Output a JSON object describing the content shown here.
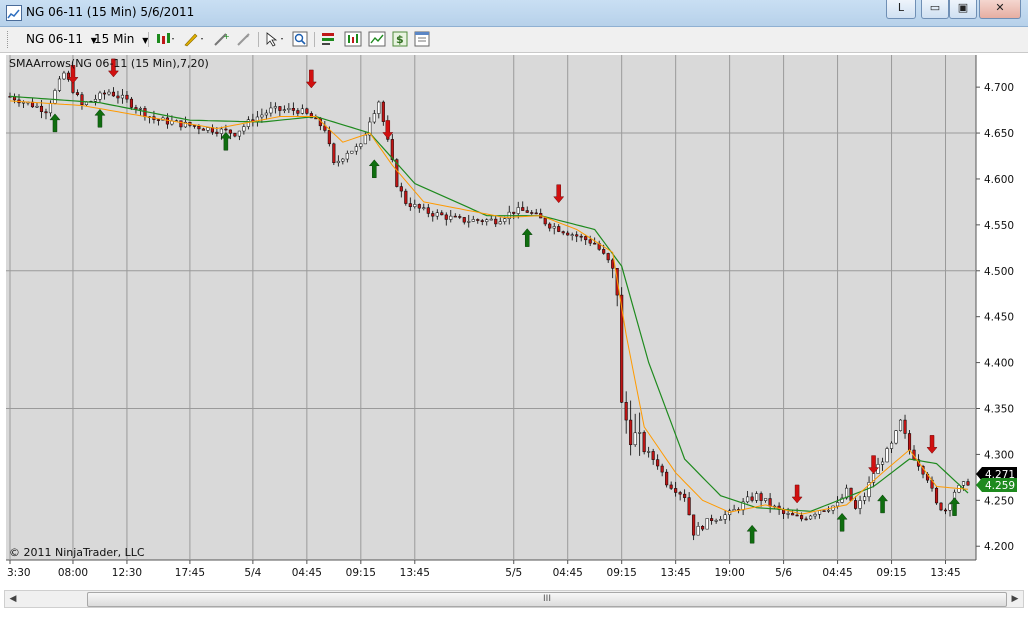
{
  "window": {
    "title": "NG 06-11 (15 Min)  5/6/2011",
    "btn_l": "L",
    "btn_min": "▭",
    "btn_max": "▣",
    "btn_close": "✕"
  },
  "toolbar": {
    "instrument": "NG 06-11",
    "interval": "15 Min"
  },
  "scroll": {
    "grip": "III"
  },
  "chart_data": {
    "type": "candlestick",
    "indicator_label": "SMAArrows(NG 06-11 (15 Min),7,20)",
    "copyright": "© 2011 NinjaTrader, LLC",
    "price_axis": {
      "ylim": [
        4.185,
        4.735
      ],
      "ticks": [
        "4.700",
        "4.650",
        "4.600",
        "4.550",
        "4.500",
        "4.450",
        "4.400",
        "4.350",
        "4.300",
        "4.250",
        "4.200"
      ],
      "tick_values": [
        4.7,
        4.65,
        4.6,
        4.55,
        4.5,
        4.45,
        4.4,
        4.35,
        4.3,
        4.25,
        4.2
      ],
      "last_price": "4.271",
      "sma_value": "4.259"
    },
    "time_axis": {
      "labels": [
        "3:30",
        "08:00",
        "12:30",
        "17:45",
        "5/4",
        "04:45",
        "09:15",
        "13:45",
        "5/5",
        "04:45",
        "09:15",
        "13:45",
        "19:00",
        "5/6",
        "04:45",
        "09:15",
        "13:45"
      ],
      "bar_index": [
        0,
        14,
        26,
        40,
        54,
        66,
        78,
        90,
        112,
        124,
        136,
        148,
        160,
        172,
        184,
        196,
        208
      ]
    },
    "total_bars": 214,
    "price_anchors": [
      [
        0,
        4.69
      ],
      [
        8,
        4.675
      ],
      [
        12,
        4.715
      ],
      [
        16,
        4.68
      ],
      [
        22,
        4.695
      ],
      [
        26,
        4.685
      ],
      [
        32,
        4.665
      ],
      [
        38,
        4.66
      ],
      [
        44,
        4.655
      ],
      [
        50,
        4.65
      ],
      [
        54,
        4.665
      ],
      [
        58,
        4.675
      ],
      [
        64,
        4.675
      ],
      [
        66,
        4.67
      ],
      [
        70,
        4.655
      ],
      [
        72,
        4.615
      ],
      [
        75,
        4.63
      ],
      [
        78,
        4.635
      ],
      [
        80,
        4.665
      ],
      [
        82,
        4.685
      ],
      [
        84,
        4.64
      ],
      [
        86,
        4.595
      ],
      [
        88,
        4.575
      ],
      [
        92,
        4.565
      ],
      [
        100,
        4.555
      ],
      [
        108,
        4.555
      ],
      [
        112,
        4.565
      ],
      [
        115,
        4.565
      ],
      [
        120,
        4.55
      ],
      [
        125,
        4.54
      ],
      [
        130,
        4.53
      ],
      [
        133,
        4.51
      ],
      [
        135,
        4.48
      ],
      [
        136,
        4.35
      ],
      [
        138,
        4.325
      ],
      [
        140,
        4.31
      ],
      [
        144,
        4.29
      ],
      [
        146,
        4.27
      ],
      [
        150,
        4.255
      ],
      [
        152,
        4.215
      ],
      [
        156,
        4.23
      ],
      [
        160,
        4.235
      ],
      [
        164,
        4.25
      ],
      [
        166,
        4.255
      ],
      [
        172,
        4.235
      ],
      [
        176,
        4.23
      ],
      [
        180,
        4.24
      ],
      [
        184,
        4.245
      ],
      [
        186,
        4.26
      ],
      [
        188,
        4.24
      ],
      [
        190,
        4.255
      ],
      [
        192,
        4.28
      ],
      [
        196,
        4.31
      ],
      [
        198,
        4.335
      ],
      [
        200,
        4.305
      ],
      [
        204,
        4.275
      ],
      [
        206,
        4.245
      ],
      [
        208,
        4.24
      ],
      [
        210,
        4.26
      ],
      [
        213,
        4.27
      ]
    ],
    "sma_fast": [
      [
        0,
        4.685
      ],
      [
        16,
        4.68
      ],
      [
        30,
        4.668
      ],
      [
        46,
        4.655
      ],
      [
        60,
        4.668
      ],
      [
        68,
        4.668
      ],
      [
        74,
        4.64
      ],
      [
        80,
        4.65
      ],
      [
        85,
        4.615
      ],
      [
        92,
        4.575
      ],
      [
        110,
        4.558
      ],
      [
        118,
        4.56
      ],
      [
        126,
        4.545
      ],
      [
        134,
        4.52
      ],
      [
        137,
        4.43
      ],
      [
        141,
        4.33
      ],
      [
        148,
        4.28
      ],
      [
        154,
        4.25
      ],
      [
        160,
        4.237
      ],
      [
        168,
        4.245
      ],
      [
        176,
        4.235
      ],
      [
        186,
        4.245
      ],
      [
        194,
        4.28
      ],
      [
        200,
        4.305
      ],
      [
        206,
        4.265
      ],
      [
        213,
        4.262
      ]
    ],
    "sma_slow": [
      [
        0,
        4.69
      ],
      [
        20,
        4.683
      ],
      [
        40,
        4.664
      ],
      [
        56,
        4.662
      ],
      [
        68,
        4.668
      ],
      [
        80,
        4.65
      ],
      [
        90,
        4.595
      ],
      [
        106,
        4.56
      ],
      [
        118,
        4.56
      ],
      [
        130,
        4.545
      ],
      [
        136,
        4.505
      ],
      [
        142,
        4.4
      ],
      [
        150,
        4.295
      ],
      [
        158,
        4.255
      ],
      [
        166,
        4.242
      ],
      [
        178,
        4.238
      ],
      [
        192,
        4.265
      ],
      [
        200,
        4.295
      ],
      [
        206,
        4.29
      ],
      [
        213,
        4.258
      ]
    ],
    "signals": [
      {
        "bar": 10,
        "dir": "up",
        "price": 4.66
      },
      {
        "bar": 14,
        "dir": "down",
        "price": 4.715
      },
      {
        "bar": 20,
        "dir": "up",
        "price": 4.665
      },
      {
        "bar": 23,
        "dir": "down",
        "price": 4.722
      },
      {
        "bar": 48,
        "dir": "up",
        "price": 4.64
      },
      {
        "bar": 67,
        "dir": "down",
        "price": 4.71
      },
      {
        "bar": 81,
        "dir": "up",
        "price": 4.61
      },
      {
        "bar": 84,
        "dir": "down",
        "price": 4.655
      },
      {
        "bar": 115,
        "dir": "up",
        "price": 4.535
      },
      {
        "bar": 122,
        "dir": "down",
        "price": 4.585
      },
      {
        "bar": 165,
        "dir": "up",
        "price": 4.212
      },
      {
        "bar": 175,
        "dir": "down",
        "price": 4.258
      },
      {
        "bar": 185,
        "dir": "up",
        "price": 4.225
      },
      {
        "bar": 192,
        "dir": "down",
        "price": 4.29
      },
      {
        "bar": 194,
        "dir": "up",
        "price": 4.245
      },
      {
        "bar": 205,
        "dir": "down",
        "price": 4.312
      },
      {
        "bar": 210,
        "dir": "up",
        "price": 4.242
      }
    ],
    "colors": {
      "background": "#d9d9d9",
      "grid": "#9a9a9a",
      "candle_up": "#ffffff",
      "candle_down": "#bf1515",
      "sma_fast": "#ff9a00",
      "sma_slow": "#1e8a1e",
      "arrow_up": "#0f6e0f",
      "arrow_down": "#d11010",
      "last_price_bg": "#000000",
      "sma_value_bg": "#1e8a1e"
    }
  }
}
